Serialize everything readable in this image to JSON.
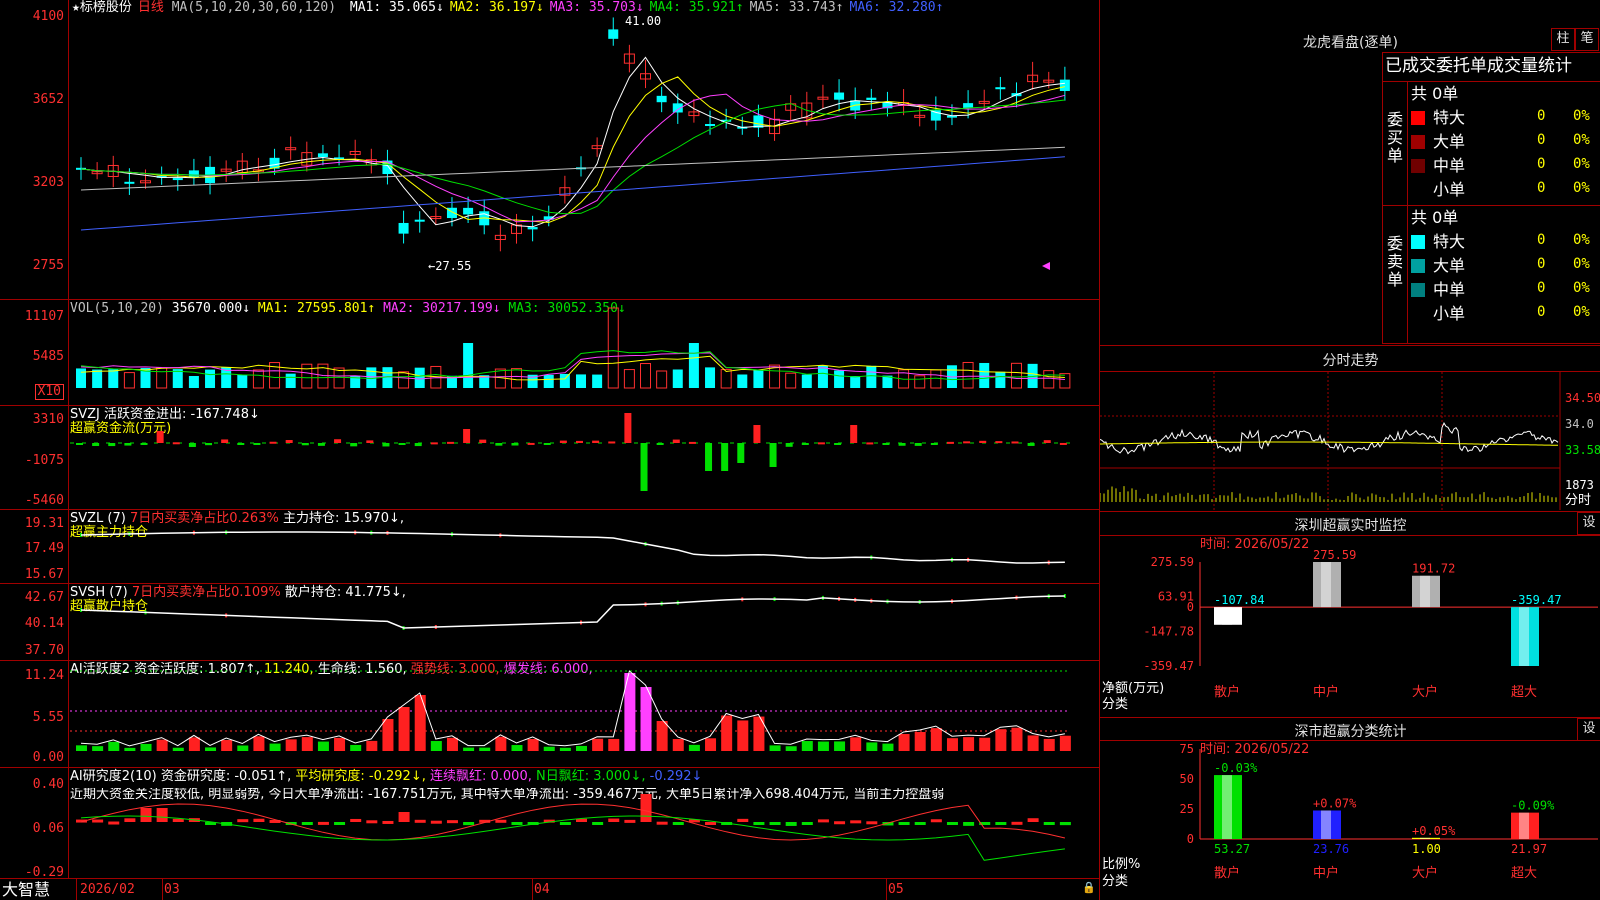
{
  "main": {
    "title_star": "★",
    "stock_name": "标榜股份",
    "period": "日线",
    "ma_label": "MA(5,10,20,30,60,120)",
    "ma": [
      {
        "label": "MA1:",
        "value": "35.065↓",
        "color": "#ffffff"
      },
      {
        "label": "MA2:",
        "value": "36.197↓",
        "color": "#ffff00"
      },
      {
        "label": "MA3:",
        "value": "35.703↓",
        "color": "#ff40ff"
      },
      {
        "label": "MA4:",
        "value": "35.921↑",
        "color": "#00e000"
      },
      {
        "label": "MA5:",
        "value": "33.743↑",
        "color": "#c0c0c0"
      },
      {
        "label": "MA6:",
        "value": "32.280↑",
        "color": "#4060ff"
      }
    ],
    "y_ticks": [
      "4100",
      "3652",
      "3203",
      "2755"
    ],
    "high_label": "41.00",
    "low_label": "←27.55"
  },
  "volume": {
    "label": "VOL(5,10,20)",
    "value": "35670.000↓",
    "ma1": "MA1: 27595.801↑",
    "ma2": "MA2: 30217.199↓",
    "ma3": "MA3: 30052.350↓",
    "y_ticks": [
      "11107",
      "5485"
    ],
    "unit": "X10"
  },
  "svzj": {
    "label": "SVZJ  活跃资金进出: -167.748↓",
    "sub": "超赢资金流(万元)",
    "y_ticks": [
      "3310",
      "-1075",
      "-5460"
    ]
  },
  "svzl": {
    "label": "SVZL (7)",
    "ratio": "7日内买卖净占比0.263%",
    "main": "主力持仓: 15.970↓,",
    "sub": "超赢主力持仓",
    "y_ticks": [
      "19.31",
      "17.49",
      "15.67"
    ]
  },
  "svsh": {
    "label": "SVSH (7)",
    "ratio": "7日内买卖净占比0.109%",
    "main": "散户持仓: 41.775↓,",
    "sub": "超赢散户持仓",
    "y_ticks": [
      "42.67",
      "40.14",
      "37.70"
    ]
  },
  "ai1": {
    "label": "AI活跃度2 资金活跃度: 1.807↑,",
    "v2": "11.240,",
    "life": "生命线: 1.560,",
    "strong": "强势线: 3.000,",
    "burst": "爆发线: 6.000,",
    "y_ticks": [
      "11.24",
      "5.55",
      "0.00"
    ]
  },
  "ai2": {
    "label": "AI研究度2(10) 资金研究度: -0.051↑,",
    "avg": "平均研究度: -0.292↓,",
    "lian": "连续飘红: 0.000,",
    "n": "N日飘红: 3.000↓,",
    "last": "-0.292↓",
    "desc": "近期大资金关注度较低, 明显弱势, 今日大单净流出: -167.751万元, 其中特大单净流出: -359.467万元, 大单5日累计净入698.404万元, 当前主力控盘弱",
    "y_ticks": [
      "0.40",
      "0.06",
      "-0.29"
    ]
  },
  "xaxis": {
    "brand": "大智慧",
    "labels": [
      "2026/02",
      "03",
      "04",
      "05"
    ]
  },
  "right": {
    "title": "龙虎看盘(逐单)",
    "btn1": "柱",
    "btn2": "笔",
    "subtitle": "已成交委托单成交量统计",
    "buy": {
      "side": "委买单",
      "total": "共 0单",
      "rows": [
        {
          "label": "特大",
          "count": "0",
          "pct": "0%",
          "color": "#ff0000"
        },
        {
          "label": "大单",
          "count": "0",
          "pct": "0%",
          "color": "#a00000"
        },
        {
          "label": "中单",
          "count": "0",
          "pct": "0%",
          "color": "#700000"
        },
        {
          "label": "小单",
          "count": "0",
          "pct": "0%",
          "color": "#000000"
        }
      ]
    },
    "sell": {
      "side": "委卖单",
      "total": "共 0单",
      "rows": [
        {
          "label": "特大",
          "count": "0",
          "pct": "0%",
          "color": "#00ffff"
        },
        {
          "label": "大单",
          "count": "0",
          "pct": "0%",
          "color": "#00a0a0"
        },
        {
          "label": "中单",
          "count": "0",
          "pct": "0%",
          "color": "#008080"
        },
        {
          "label": "小单",
          "count": "0",
          "pct": "0%",
          "color": "#000000"
        }
      ]
    },
    "intraday": {
      "title": "分时走势",
      "prices": [
        "34.50",
        "34.0",
        "33.58"
      ],
      "vol": "1873",
      "vol_unit": "分时"
    },
    "monitor": {
      "title": "深圳超赢实时监控",
      "btn": "设",
      "time": "时间: 2026/05/22",
      "y_ticks": [
        "275.59",
        "63.91",
        "0",
        "-147.78",
        "-359.47"
      ],
      "ylabel": "净额(万元)",
      "xlabel": "分类",
      "categories": [
        "散户",
        "中户",
        "大户",
        "超大"
      ],
      "values": [
        "-107.84",
        "275.59",
        "191.72",
        "-359.47"
      ]
    },
    "classify": {
      "title": "深市超赢分类统计",
      "btn": "设",
      "time": "时间: 2026/05/22",
      "y_ticks": [
        "75",
        "50",
        "25",
        "0"
      ],
      "ylabel": "比例%",
      "xlabel": "分类",
      "categories": [
        "散户",
        "中户",
        "大户",
        "超大"
      ],
      "values": [
        "53.27",
        "23.76",
        "1.00",
        "21.97"
      ],
      "changes": [
        "-0.03%",
        "+0.07%",
        "+0.05%",
        "-0.09%"
      ]
    }
  },
  "chart_data": [
    {
      "type": "bar",
      "title": "深圳超赢实时监控",
      "ylabel": "净额(万元)",
      "xlabel": "分类",
      "categories": [
        "散户",
        "中户",
        "大户",
        "超大"
      ],
      "values": [
        -107.84,
        275.59,
        191.72,
        -359.47
      ],
      "ylim": [
        -359.47,
        275.59
      ]
    },
    {
      "type": "bar",
      "title": "深市超赢分类统计",
      "ylabel": "比例%",
      "xlabel": "分类",
      "categories": [
        "散户",
        "中户",
        "大户",
        "超大"
      ],
      "values": [
        53.27,
        23.76,
        1.0,
        21.97
      ],
      "ylim": [
        0,
        75
      ]
    }
  ]
}
